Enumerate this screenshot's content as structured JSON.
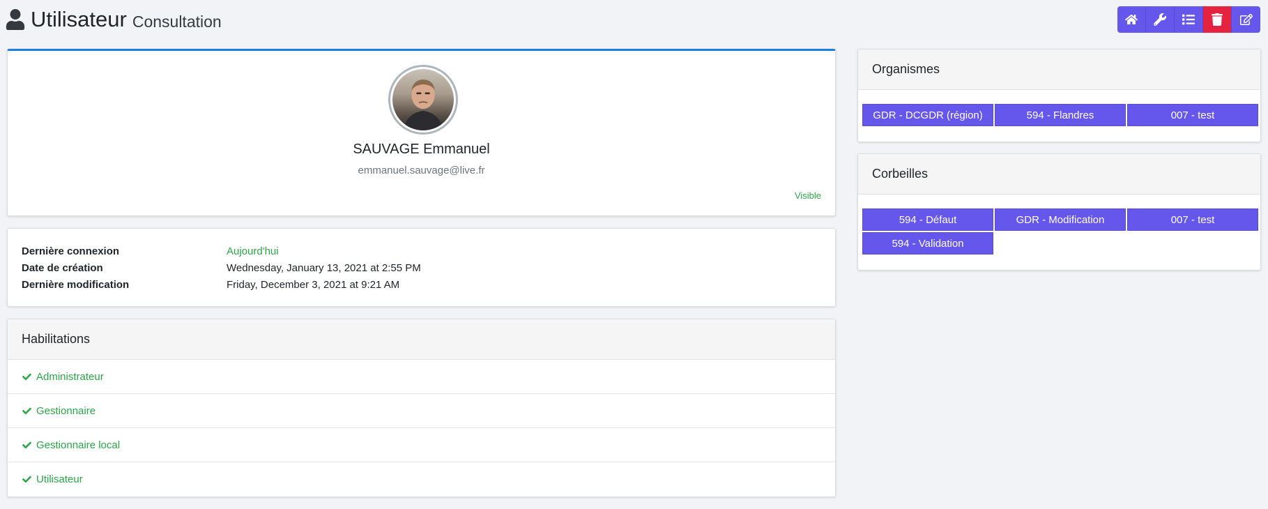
{
  "header": {
    "title": "Utilisateur",
    "subtitle": "Consultation"
  },
  "toolbar": {
    "buttons": [
      {
        "icon": "home-icon"
      },
      {
        "icon": "wrench-icon"
      },
      {
        "icon": "list-icon"
      },
      {
        "icon": "trash-icon",
        "color": "#e3233f"
      },
      {
        "icon": "edit-icon"
      }
    ],
    "accent": "#6657ec"
  },
  "profile": {
    "name": "SAUVAGE Emmanuel",
    "email": "emmanuel.sauvage@live.fr",
    "visibility": "Visible"
  },
  "info": {
    "rows": [
      {
        "label": "Dernière connexion",
        "value": "Aujourd'hui"
      },
      {
        "label": "Date de création",
        "value": "Wednesday, January 13, 2021 at 2:55 PM"
      },
      {
        "label": "Dernière modification",
        "value": "Friday, December 3, 2021 at 9:21 AM"
      }
    ]
  },
  "habilitations": {
    "title": "Habilitations",
    "items": [
      "Administrateur",
      "Gestionnaire",
      "Gestionnaire local",
      "Utilisateur"
    ]
  },
  "organismes": {
    "title": "Organismes",
    "items": [
      "GDR - DCGDR (région)",
      "594 - Flandres",
      "007 - test"
    ]
  },
  "corbeilles": {
    "title": "Corbeilles",
    "items": [
      "594 - Défaut",
      "GDR - Modification",
      "007 - test",
      "594 - Validation"
    ]
  }
}
